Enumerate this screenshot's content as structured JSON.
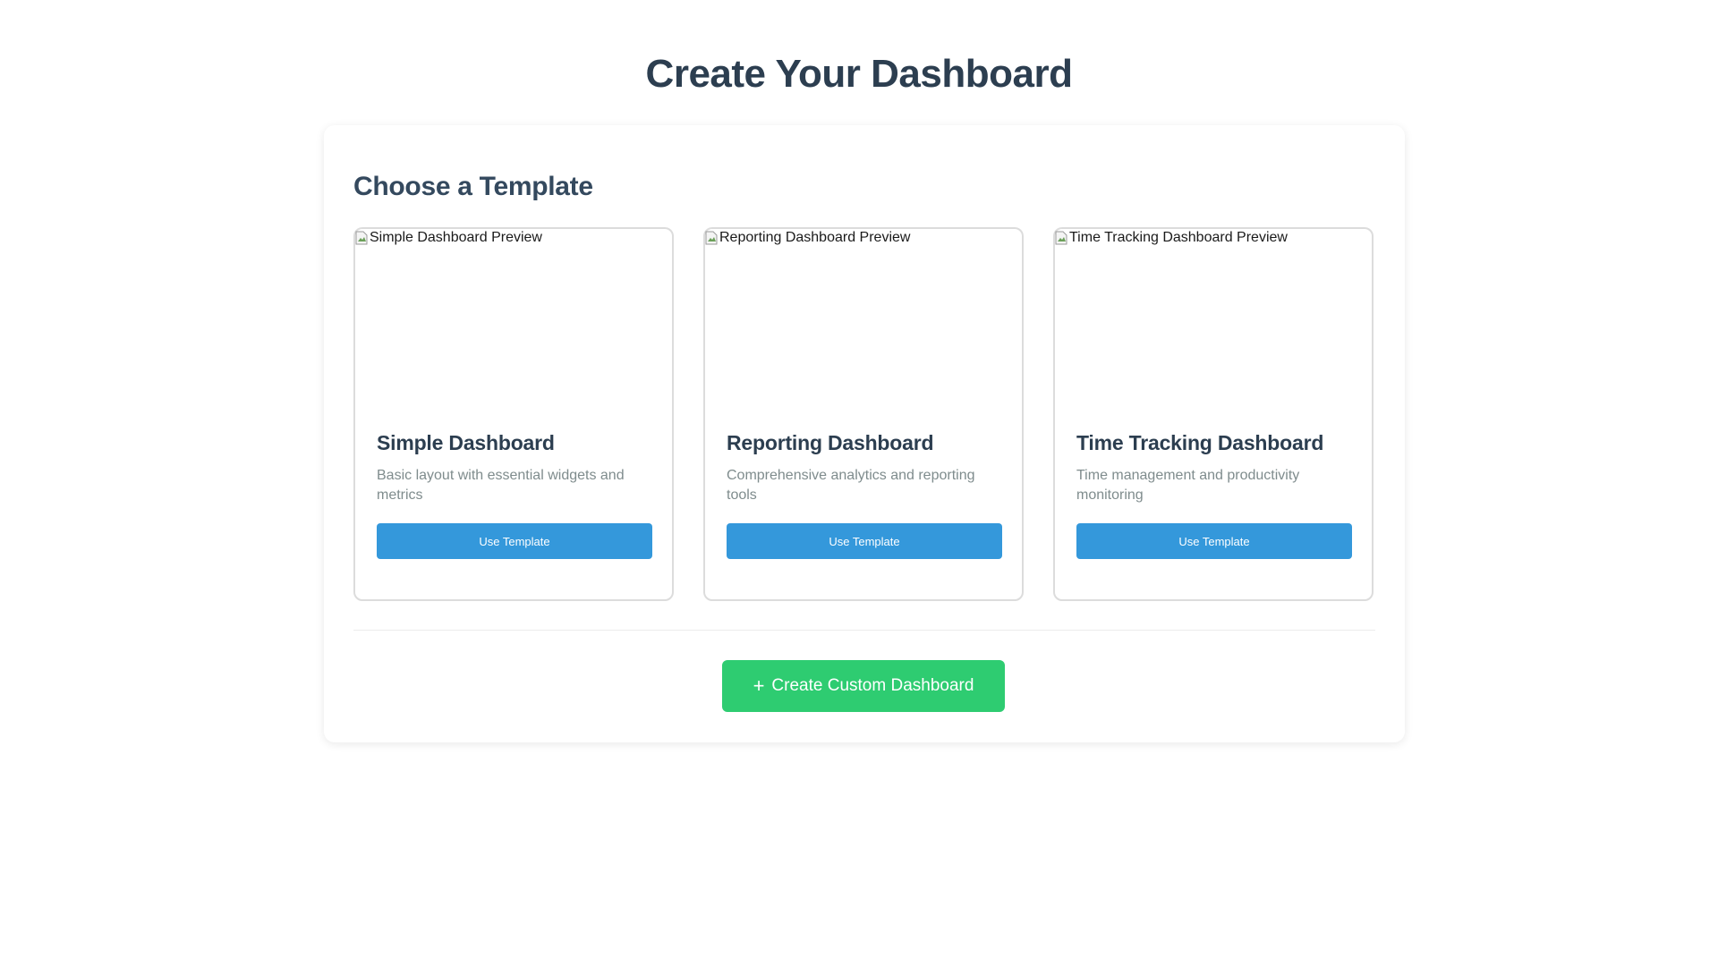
{
  "header": {
    "title": "Create Your Dashboard"
  },
  "panel": {
    "section_title": "Choose a Template",
    "templates": [
      {
        "preview_alt": "Simple Dashboard Preview",
        "title": "Simple Dashboard",
        "description": "Basic layout with essential widgets and metrics",
        "button_label": "Use Template"
      },
      {
        "preview_alt": "Reporting Dashboard Preview",
        "title": "Reporting Dashboard",
        "description": "Comprehensive analytics and reporting tools",
        "button_label": "Use Template"
      },
      {
        "preview_alt": "Time Tracking Dashboard Preview",
        "title": "Time Tracking Dashboard",
        "description": "Time management and productivity monitoring",
        "button_label": "Use Template"
      }
    ],
    "custom_button": {
      "icon": "plus-icon",
      "icon_glyph": "+",
      "label": "Create Custom Dashboard"
    }
  },
  "colors": {
    "primary_button": "#3498db",
    "success_button": "#2ecc71",
    "heading": "#2c3e50",
    "muted_text": "#7f8c8d"
  }
}
